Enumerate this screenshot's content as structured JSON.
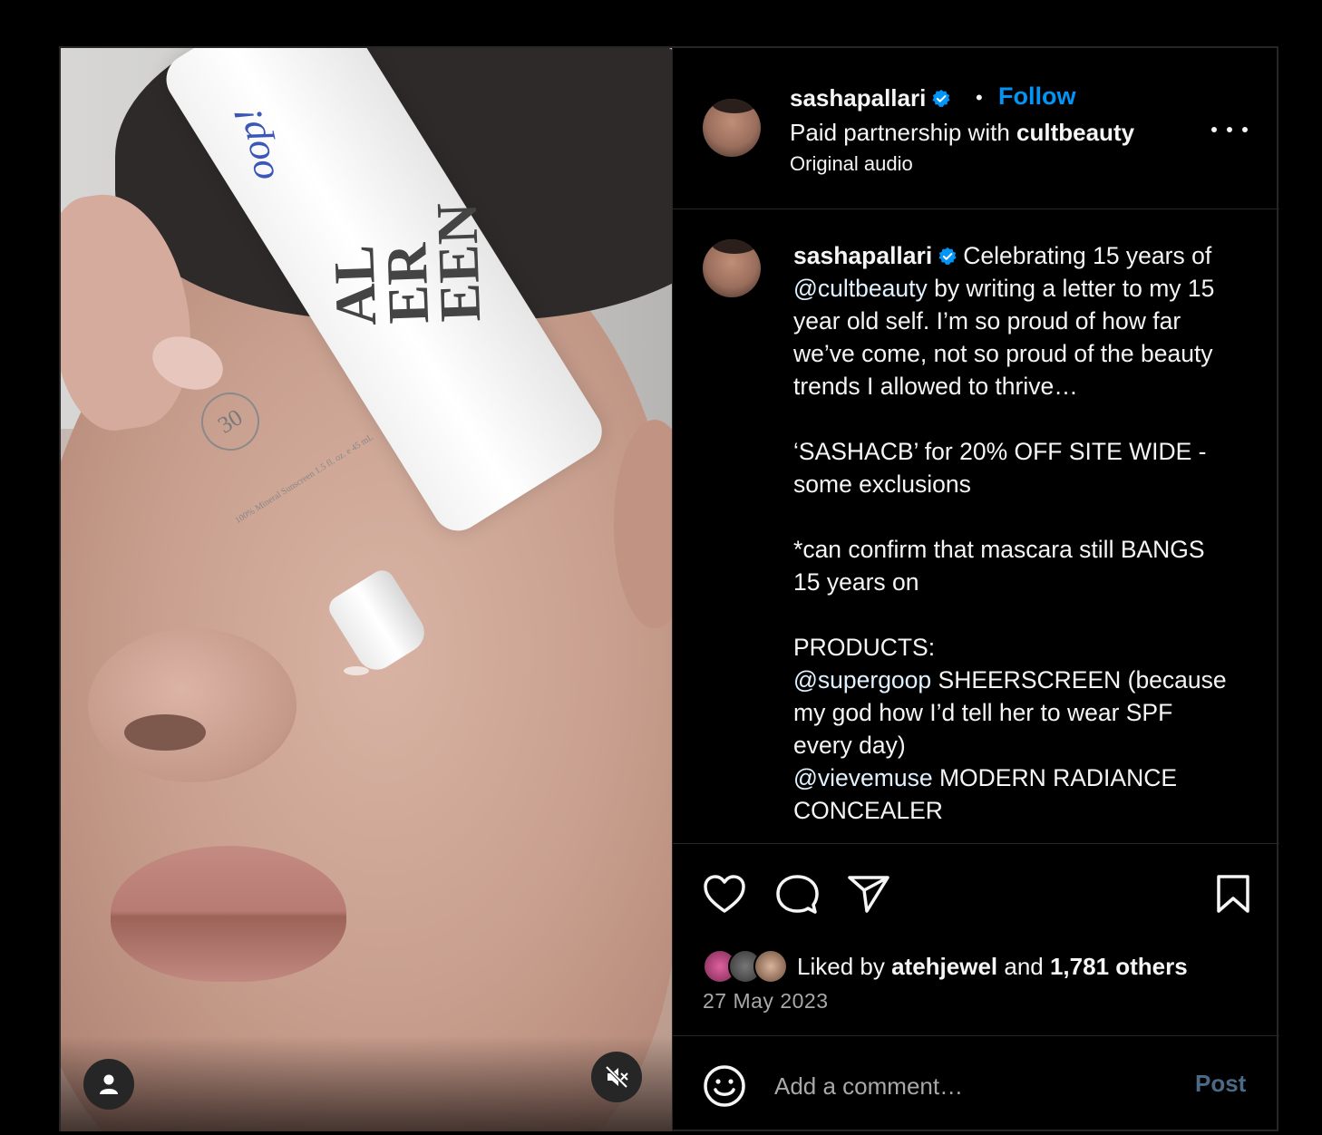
{
  "header": {
    "username": "sashapallari",
    "separator": "•",
    "follow_label": "Follow",
    "partnership_prefix": "Paid partnership with ",
    "partner_name": "cultbeauty",
    "audio": "Original audio"
  },
  "media": {
    "tube_brand": "oop!",
    "tube_text": "AL\nER\nEEN",
    "tube_spf": "30",
    "tube_small_text": "100% Mineral Sunscreen 1.5 fl. oz. e 45 mL"
  },
  "caption": {
    "username": "sashapallari",
    "parts": [
      {
        "text": "Celebrating 15 years of ",
        "mention": false
      },
      {
        "text": "@cultbeauty",
        "mention": true
      },
      {
        "text": " by writing a letter to my 15 year old self. I’m so proud of how far we’ve come, not so proud of the beauty trends I allowed to thrive…\n\n‘SASHACB’ for 20% OFF SITE WIDE - some exclusions\n\n*can confirm that mascara still BANGS 15 years on\n\nPRODUCTS:\n",
        "mention": false
      },
      {
        "text": "@supergoop",
        "mention": true
      },
      {
        "text": " SHEERSCREEN (because my god how I’d tell her to wear SPF every day)\n",
        "mention": false
      },
      {
        "text": "@vievemuse",
        "mention": true
      },
      {
        "text": " MODERN RADIANCE CONCEALER",
        "mention": false
      }
    ]
  },
  "likes": {
    "prefix": "Liked by ",
    "first_liker": "atehjewel",
    "and": " and ",
    "others": "1,781 others"
  },
  "date": "27 May 2023",
  "comment": {
    "placeholder": "Add a comment…",
    "post_label": "Post"
  },
  "colors": {
    "background": "#000000",
    "link_blue": "#0095f6",
    "mention": "#e0f1ff",
    "secondary_text": "#a8a8a8",
    "border": "#262626",
    "verified": "#0095f6"
  },
  "icons": [
    "verified-badge-icon",
    "more-options-icon",
    "heart-icon",
    "comment-icon",
    "share-icon",
    "bookmark-icon",
    "emoji-icon",
    "user-tag-icon",
    "muted-speaker-icon"
  ]
}
